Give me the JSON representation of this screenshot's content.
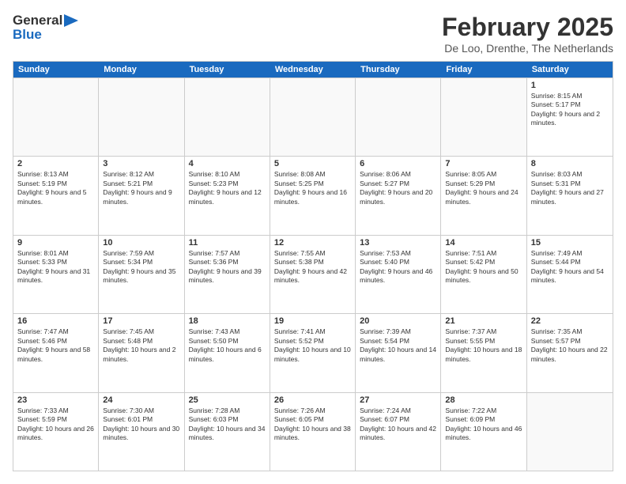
{
  "header": {
    "logo_general": "General",
    "logo_blue": "Blue",
    "month_year": "February 2025",
    "location": "De Loo, Drenthe, The Netherlands"
  },
  "days_of_week": [
    "Sunday",
    "Monday",
    "Tuesday",
    "Wednesday",
    "Thursday",
    "Friday",
    "Saturday"
  ],
  "weeks": [
    [
      {
        "day": "",
        "info": "",
        "empty": true
      },
      {
        "day": "",
        "info": "",
        "empty": true
      },
      {
        "day": "",
        "info": "",
        "empty": true
      },
      {
        "day": "",
        "info": "",
        "empty": true
      },
      {
        "day": "",
        "info": "",
        "empty": true
      },
      {
        "day": "",
        "info": "",
        "empty": true
      },
      {
        "day": "1",
        "info": "Sunrise: 8:15 AM\nSunset: 5:17 PM\nDaylight: 9 hours and 2 minutes.",
        "empty": false
      }
    ],
    [
      {
        "day": "2",
        "info": "Sunrise: 8:13 AM\nSunset: 5:19 PM\nDaylight: 9 hours and 5 minutes.",
        "empty": false
      },
      {
        "day": "3",
        "info": "Sunrise: 8:12 AM\nSunset: 5:21 PM\nDaylight: 9 hours and 9 minutes.",
        "empty": false
      },
      {
        "day": "4",
        "info": "Sunrise: 8:10 AM\nSunset: 5:23 PM\nDaylight: 9 hours and 12 minutes.",
        "empty": false
      },
      {
        "day": "5",
        "info": "Sunrise: 8:08 AM\nSunset: 5:25 PM\nDaylight: 9 hours and 16 minutes.",
        "empty": false
      },
      {
        "day": "6",
        "info": "Sunrise: 8:06 AM\nSunset: 5:27 PM\nDaylight: 9 hours and 20 minutes.",
        "empty": false
      },
      {
        "day": "7",
        "info": "Sunrise: 8:05 AM\nSunset: 5:29 PM\nDaylight: 9 hours and 24 minutes.",
        "empty": false
      },
      {
        "day": "8",
        "info": "Sunrise: 8:03 AM\nSunset: 5:31 PM\nDaylight: 9 hours and 27 minutes.",
        "empty": false
      }
    ],
    [
      {
        "day": "9",
        "info": "Sunrise: 8:01 AM\nSunset: 5:33 PM\nDaylight: 9 hours and 31 minutes.",
        "empty": false
      },
      {
        "day": "10",
        "info": "Sunrise: 7:59 AM\nSunset: 5:34 PM\nDaylight: 9 hours and 35 minutes.",
        "empty": false
      },
      {
        "day": "11",
        "info": "Sunrise: 7:57 AM\nSunset: 5:36 PM\nDaylight: 9 hours and 39 minutes.",
        "empty": false
      },
      {
        "day": "12",
        "info": "Sunrise: 7:55 AM\nSunset: 5:38 PM\nDaylight: 9 hours and 42 minutes.",
        "empty": false
      },
      {
        "day": "13",
        "info": "Sunrise: 7:53 AM\nSunset: 5:40 PM\nDaylight: 9 hours and 46 minutes.",
        "empty": false
      },
      {
        "day": "14",
        "info": "Sunrise: 7:51 AM\nSunset: 5:42 PM\nDaylight: 9 hours and 50 minutes.",
        "empty": false
      },
      {
        "day": "15",
        "info": "Sunrise: 7:49 AM\nSunset: 5:44 PM\nDaylight: 9 hours and 54 minutes.",
        "empty": false
      }
    ],
    [
      {
        "day": "16",
        "info": "Sunrise: 7:47 AM\nSunset: 5:46 PM\nDaylight: 9 hours and 58 minutes.",
        "empty": false
      },
      {
        "day": "17",
        "info": "Sunrise: 7:45 AM\nSunset: 5:48 PM\nDaylight: 10 hours and 2 minutes.",
        "empty": false
      },
      {
        "day": "18",
        "info": "Sunrise: 7:43 AM\nSunset: 5:50 PM\nDaylight: 10 hours and 6 minutes.",
        "empty": false
      },
      {
        "day": "19",
        "info": "Sunrise: 7:41 AM\nSunset: 5:52 PM\nDaylight: 10 hours and 10 minutes.",
        "empty": false
      },
      {
        "day": "20",
        "info": "Sunrise: 7:39 AM\nSunset: 5:54 PM\nDaylight: 10 hours and 14 minutes.",
        "empty": false
      },
      {
        "day": "21",
        "info": "Sunrise: 7:37 AM\nSunset: 5:55 PM\nDaylight: 10 hours and 18 minutes.",
        "empty": false
      },
      {
        "day": "22",
        "info": "Sunrise: 7:35 AM\nSunset: 5:57 PM\nDaylight: 10 hours and 22 minutes.",
        "empty": false
      }
    ],
    [
      {
        "day": "23",
        "info": "Sunrise: 7:33 AM\nSunset: 5:59 PM\nDaylight: 10 hours and 26 minutes.",
        "empty": false
      },
      {
        "day": "24",
        "info": "Sunrise: 7:30 AM\nSunset: 6:01 PM\nDaylight: 10 hours and 30 minutes.",
        "empty": false
      },
      {
        "day": "25",
        "info": "Sunrise: 7:28 AM\nSunset: 6:03 PM\nDaylight: 10 hours and 34 minutes.",
        "empty": false
      },
      {
        "day": "26",
        "info": "Sunrise: 7:26 AM\nSunset: 6:05 PM\nDaylight: 10 hours and 38 minutes.",
        "empty": false
      },
      {
        "day": "27",
        "info": "Sunrise: 7:24 AM\nSunset: 6:07 PM\nDaylight: 10 hours and 42 minutes.",
        "empty": false
      },
      {
        "day": "28",
        "info": "Sunrise: 7:22 AM\nSunset: 6:09 PM\nDaylight: 10 hours and 46 minutes.",
        "empty": false
      },
      {
        "day": "",
        "info": "",
        "empty": true
      }
    ]
  ]
}
